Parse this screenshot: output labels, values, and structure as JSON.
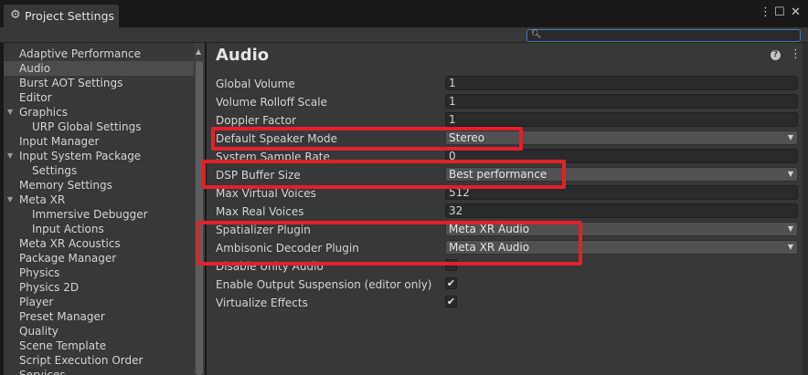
{
  "window": {
    "tab_title": "Project Settings",
    "kebab": "⋮",
    "maximize": "☐",
    "close": "✕"
  },
  "search": {
    "placeholder": "",
    "icon": "search-icon"
  },
  "sidebar": {
    "items": [
      {
        "label": "Adaptive Performance"
      },
      {
        "label": "Audio",
        "selected": true
      },
      {
        "label": "Burst AOT Settings"
      },
      {
        "label": "Editor"
      },
      {
        "label": "Graphics",
        "expanded": true
      },
      {
        "label": "URP Global Settings",
        "child": true
      },
      {
        "label": "Input Manager"
      },
      {
        "label": "Input System Package",
        "expanded": true
      },
      {
        "label": "Settings",
        "child": true
      },
      {
        "label": "Memory Settings"
      },
      {
        "label": "Meta XR",
        "expanded": true
      },
      {
        "label": "Immersive Debugger",
        "child": true
      },
      {
        "label": "Input Actions",
        "child": true
      },
      {
        "label": "Meta XR Acoustics"
      },
      {
        "label": "Package Manager"
      },
      {
        "label": "Physics"
      },
      {
        "label": "Physics 2D"
      },
      {
        "label": "Player"
      },
      {
        "label": "Preset Manager"
      },
      {
        "label": "Quality"
      },
      {
        "label": "Scene Template"
      },
      {
        "label": "Script Execution Order"
      },
      {
        "label": "Services"
      }
    ]
  },
  "main": {
    "title": "Audio",
    "settings": [
      {
        "label": "Global Volume",
        "type": "text",
        "value": "1"
      },
      {
        "label": "Volume Rolloff Scale",
        "type": "text",
        "value": "1"
      },
      {
        "label": "Doppler Factor",
        "type": "text",
        "value": "1"
      },
      {
        "label": "Default Speaker Mode",
        "type": "dropdown",
        "value": "Stereo"
      },
      {
        "label": "System Sample Rate",
        "type": "text",
        "value": "0"
      },
      {
        "label": "DSP Buffer Size",
        "type": "dropdown",
        "value": "Best performance"
      },
      {
        "label": "Max Virtual Voices",
        "type": "text",
        "value": "512"
      },
      {
        "label": "Max Real Voices",
        "type": "text",
        "value": "32"
      },
      {
        "label": "Spatializer Plugin",
        "type": "dropdown",
        "value": "Meta XR Audio"
      },
      {
        "label": "Ambisonic Decoder Plugin",
        "type": "dropdown",
        "value": "Meta XR Audio"
      },
      {
        "label": "Disable Unity Audio",
        "type": "checkbox",
        "checked": false
      },
      {
        "label": "Enable Output Suspension (editor only)",
        "type": "checkbox",
        "checked": true
      },
      {
        "label": "Virtualize Effects",
        "type": "checkbox",
        "checked": true
      }
    ]
  },
  "colors": {
    "highlight": "#e3202a",
    "background": "#383838",
    "search_focus": "#3a79bb"
  }
}
